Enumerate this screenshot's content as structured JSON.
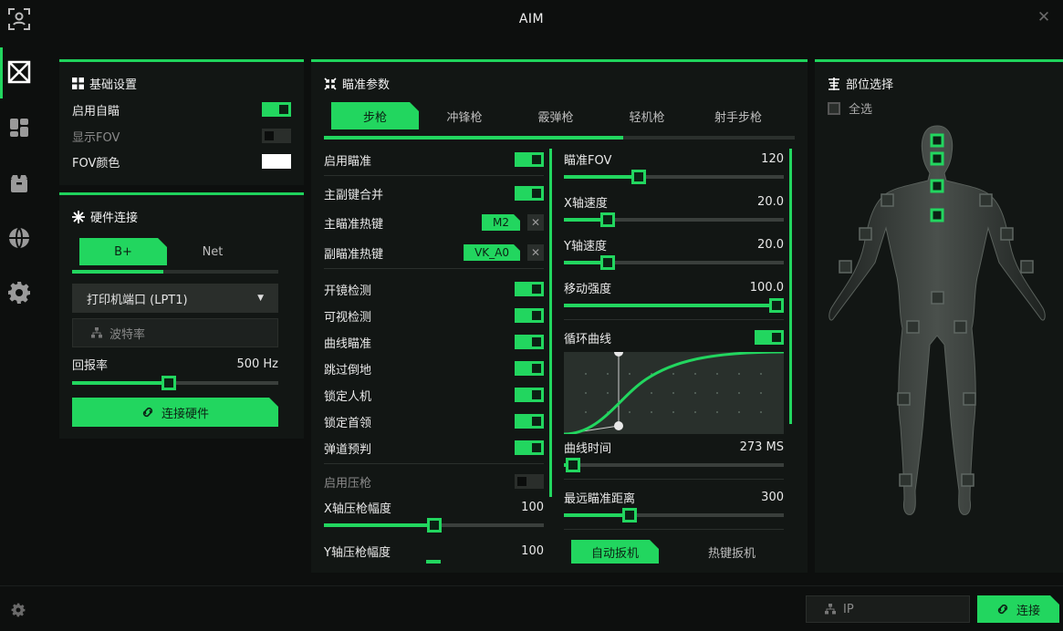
{
  "window": {
    "title": "AIM"
  },
  "colors": {
    "accent": "#22d65f",
    "panel": "#121614",
    "background": "#0d0f0e"
  },
  "sidebar": {
    "icons": [
      "user-focus-icon",
      "crosshair-box-icon",
      "dashboard-icon",
      "package-icon",
      "globe-icon",
      "gear-icon"
    ],
    "active_index": 1
  },
  "basic": {
    "title": "基础设置",
    "enable_aim": {
      "label": "启用自瞄",
      "on": true
    },
    "show_fov": {
      "label": "显示FOV",
      "on": false
    },
    "fov_color": {
      "label": "FOV颜色",
      "value": "#ffffff"
    }
  },
  "hardware": {
    "title": "硬件连接",
    "tabs": [
      "B+",
      "Net"
    ],
    "active_tab": 0,
    "port_select": "打印机端口 (LPT1)",
    "baud_placeholder": "波特率",
    "report_rate": {
      "label": "回报率",
      "value_text": "500 Hz",
      "fraction": 0.47
    },
    "connect_label": "连接硬件"
  },
  "aim": {
    "title": "瞄准参数",
    "tabs": [
      "步枪",
      "冲锋枪",
      "霰弹枪",
      "轻机枪",
      "射手步枪"
    ],
    "active_tab": 0,
    "left": {
      "enable_aim": "启用瞄准",
      "merge_keys": "主副键合并",
      "main_hotkey": {
        "label": "主瞄准热键",
        "value": "M2"
      },
      "sub_hotkey": {
        "label": "副瞄准热键",
        "value": "VK_A0"
      },
      "scope_detect": "开镜检测",
      "visible_detect": "可视检测",
      "curve_aim": "曲线瞄准",
      "skip_downed": "跳过倒地",
      "lock_bot": "锁定人机",
      "lock_leader": "锁定首领",
      "ballistic": "弹道预判",
      "recoil_enable": "启用压枪",
      "x_recoil": {
        "label": "X轴压枪幅度",
        "value": "100",
        "fraction": 0.5
      },
      "y_recoil": {
        "label": "Y轴压枪幅度",
        "value": "100",
        "fraction": 0.5
      }
    },
    "right": {
      "fov": {
        "label": "瞄准FOV",
        "value": "120",
        "fraction": 0.34
      },
      "x_speed": {
        "label": "X轴速度",
        "value": "20.0",
        "fraction": 0.2
      },
      "y_speed": {
        "label": "Y轴速度",
        "value": "20.0",
        "fraction": 0.2
      },
      "move_strength": {
        "label": "移动强度",
        "value": "100.0",
        "fraction": 1.0
      },
      "loop_curve": "循环曲线",
      "curve_time": {
        "label": "曲线时间",
        "value": "273 MS",
        "fraction": 0.04
      },
      "max_distance": {
        "label": "最远瞄准距离",
        "value": "300",
        "fraction": 0.3
      },
      "trigger_tabs": [
        "自动扳机",
        "热键扳机"
      ]
    }
  },
  "body_select": {
    "title": "部位选择",
    "select_all": "全选"
  },
  "bottom": {
    "ip_placeholder": "IP",
    "connect_label": "连接"
  }
}
